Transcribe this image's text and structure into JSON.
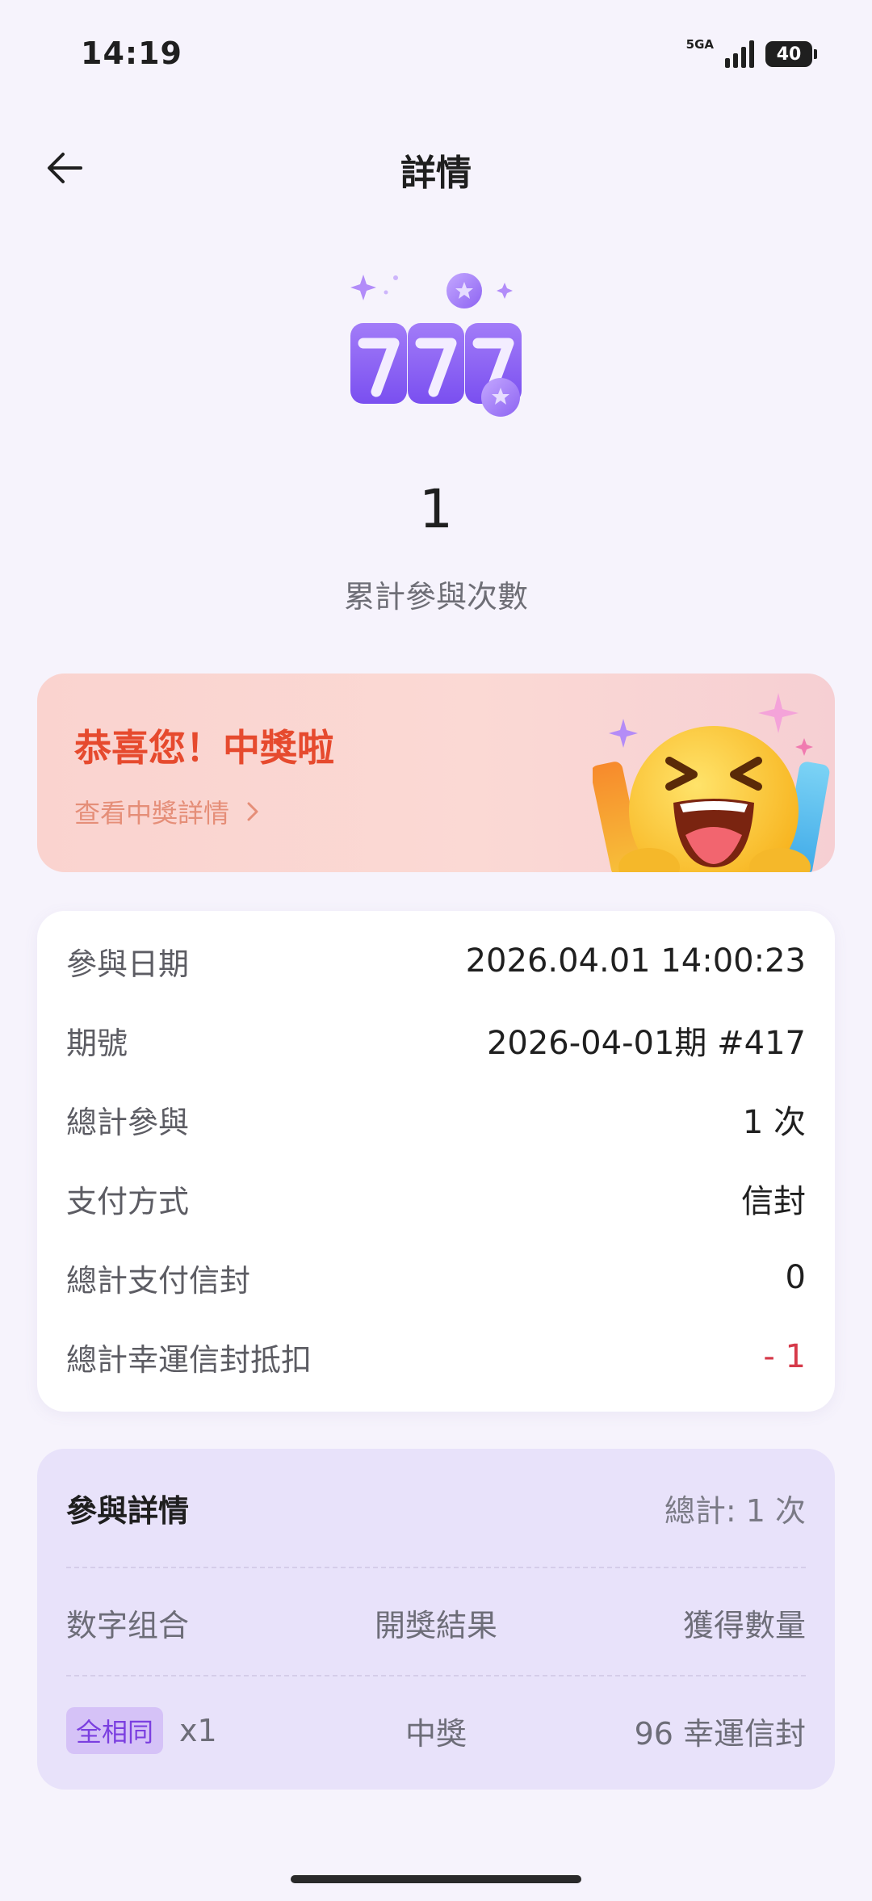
{
  "status_bar": {
    "time": "14:19",
    "network": "5GA",
    "battery": "40"
  },
  "header": {
    "title": "詳情"
  },
  "summary": {
    "count": "1",
    "count_label": "累計參與次數"
  },
  "win_banner": {
    "title": "恭喜您！中獎啦",
    "link_label": "查看中獎詳情"
  },
  "info": {
    "rows": [
      {
        "label": "參與日期",
        "value": "2026.04.01 14:00:23"
      },
      {
        "label": "期號",
        "value": "2026-04-01期 #417"
      },
      {
        "label": "總計參與",
        "value": "1 次"
      },
      {
        "label": "支付方式",
        "value": "信封"
      },
      {
        "label": "總計支付信封",
        "value": "0"
      },
      {
        "label": "總計幸運信封抵扣",
        "value": "- 1",
        "color": "#d63a4a"
      }
    ]
  },
  "details": {
    "title": "參與詳情",
    "total": "總計: 1 次",
    "columns": [
      "数字组合",
      "開獎結果",
      "獲得數量"
    ],
    "rows": [
      {
        "tag": "全相同",
        "multiplier": "x1",
        "result": "中獎",
        "amount": "96 幸運信封"
      }
    ]
  },
  "icons": {
    "back": "arrow-left-icon",
    "chevron": "chevron-right-icon",
    "hero": "slot-777-icon",
    "emoji": "laughing-emoji-illustration"
  },
  "colors": {
    "background": "#f6f3fc",
    "accent_purple": "#8b5cf6",
    "win_red": "#e64a2e",
    "negative_red": "#d63a4a"
  }
}
